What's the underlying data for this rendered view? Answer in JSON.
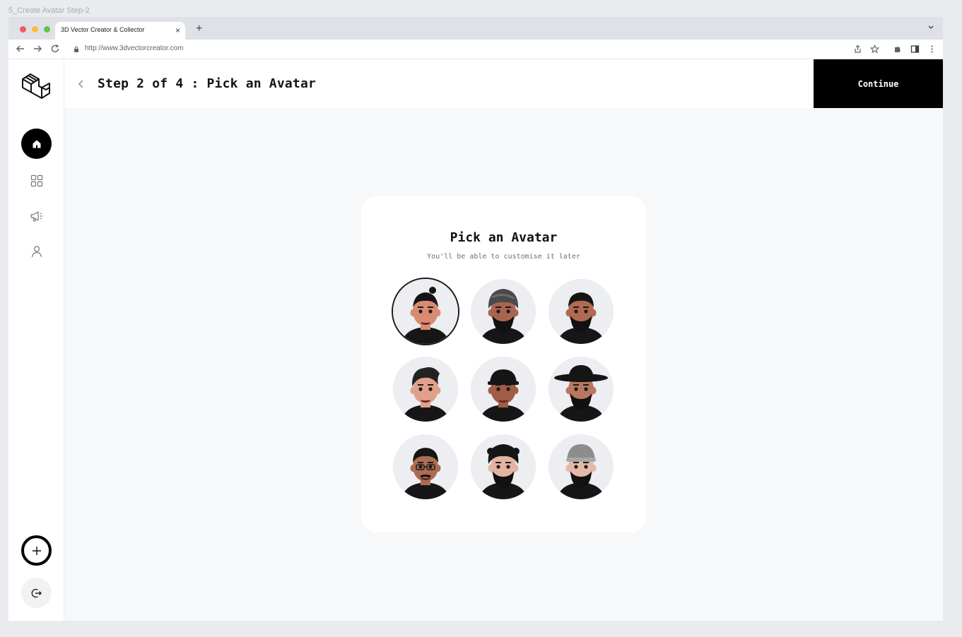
{
  "frame_label": "5_Create Avatar Step-2",
  "browser": {
    "tab_title": "3D Vector Creator & Collector",
    "tab_close": "×",
    "new_tab": "+",
    "url": "http://www.3dvectorcreator.com"
  },
  "header": {
    "title": "Step 2 of 4 : Pick an Avatar",
    "continue_label": "Continue"
  },
  "card": {
    "title": "Pick an Avatar",
    "subtitle": "You'll be able to customise it later"
  },
  "avatars": [
    {
      "name": "avatar-topknot",
      "selected": true,
      "skin": "#d98b72",
      "hair": "#151515",
      "beard": false,
      "hat": "topknot"
    },
    {
      "name": "avatar-turban",
      "selected": false,
      "skin": "#a9644f",
      "hair": "#4a4a4a",
      "beard": true,
      "hat": "turban"
    },
    {
      "name": "avatar-bearded",
      "selected": false,
      "skin": "#b06a52",
      "hair": "#151515",
      "beard": true,
      "hat": "none"
    },
    {
      "name": "avatar-quiff",
      "selected": false,
      "skin": "#e0a08a",
      "hair": "#222222",
      "beard": false,
      "hat": "quiff"
    },
    {
      "name": "avatar-cap",
      "selected": false,
      "skin": "#a25c45",
      "hair": "#151515",
      "beard": false,
      "hat": "cap"
    },
    {
      "name": "avatar-fedora",
      "selected": false,
      "skin": "#b97660",
      "hair": "#151515",
      "beard": true,
      "hat": "fedora"
    },
    {
      "name": "avatar-glasses",
      "selected": false,
      "skin": "#ad6c52",
      "hair": "#151515",
      "beard": false,
      "hat": "glasses"
    },
    {
      "name": "avatar-curly-beard",
      "selected": false,
      "skin": "#e3b3a2",
      "hair": "#151515",
      "beard": true,
      "hat": "curly"
    },
    {
      "name": "avatar-beanie",
      "selected": false,
      "skin": "#e6b8a8",
      "hair": "#8d8d8d",
      "beard": true,
      "hat": "beanie"
    }
  ],
  "colors": {
    "accent": "#000000",
    "background": "#f7f8fa",
    "card": "#ffffff"
  },
  "icons": {
    "sidebar": [
      "home-icon",
      "grid-icon",
      "megaphone-icon",
      "user-icon",
      "plus-icon",
      "logout-icon"
    ]
  }
}
